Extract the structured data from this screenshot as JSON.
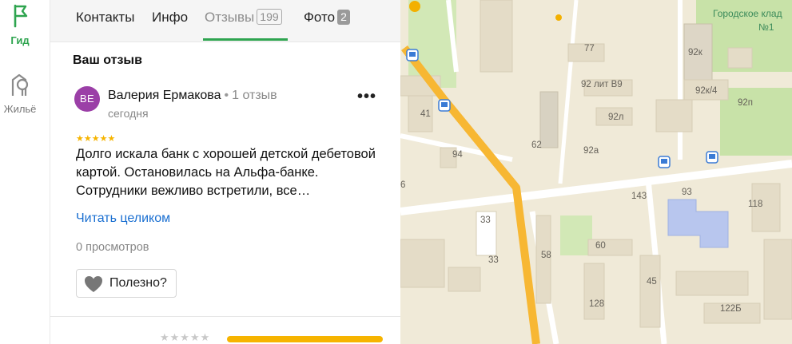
{
  "sidebar": {
    "items": [
      {
        "label": "Гид",
        "icon": "flag-icon",
        "active": true
      },
      {
        "label": "Жильё",
        "icon": "building-icon",
        "active": false
      }
    ]
  },
  "tabs": {
    "contacts": "Контакты",
    "info": "Инфо",
    "reviews": "Отзывы",
    "reviews_count": "199",
    "photos": "Фото",
    "photos_count": "2",
    "active": "reviews"
  },
  "review": {
    "section_title": "Ваш отзыв",
    "avatar_initials": "ВЕ",
    "author": "Валерия Ермакова",
    "separator": "•",
    "author_reviews": "1 отзыв",
    "date": "сегодня",
    "rating": "★★★★★",
    "text": "Долго искала банк с хорошей детской дебетовой картой. Остановилась на Альфа-банке. Сотрудники вежливо встретили, все…",
    "read_more": "Читать целиком",
    "views": "0 просмотров",
    "useful_label": "Полезно?"
  },
  "rating_summary": {
    "stars": "★★★★★"
  },
  "map": {
    "labels": {
      "cemetery": "Городское клад",
      "cemetery_no": "№1",
      "b77": "77",
      "b92k": "92к",
      "b92lit": "92 лит В9",
      "b92k4": "92к/4",
      "b92l": "92л",
      "b92p": "92п",
      "b41": "41",
      "b62": "62",
      "b92a": "92а",
      "b94": "94",
      "b6": "6",
      "b143": "143",
      "b93": "93",
      "b118": "118",
      "b33a": "33",
      "b33b": "33",
      "b60": "60",
      "b58": "58",
      "b45": "45",
      "b128": "128",
      "b122b": "122Б"
    },
    "colors": {
      "main_road": "#f7b733",
      "background": "#f0ead8",
      "park": "#c8e2a8",
      "building": "#e4dcc7",
      "school": "#b8c6ee"
    }
  }
}
